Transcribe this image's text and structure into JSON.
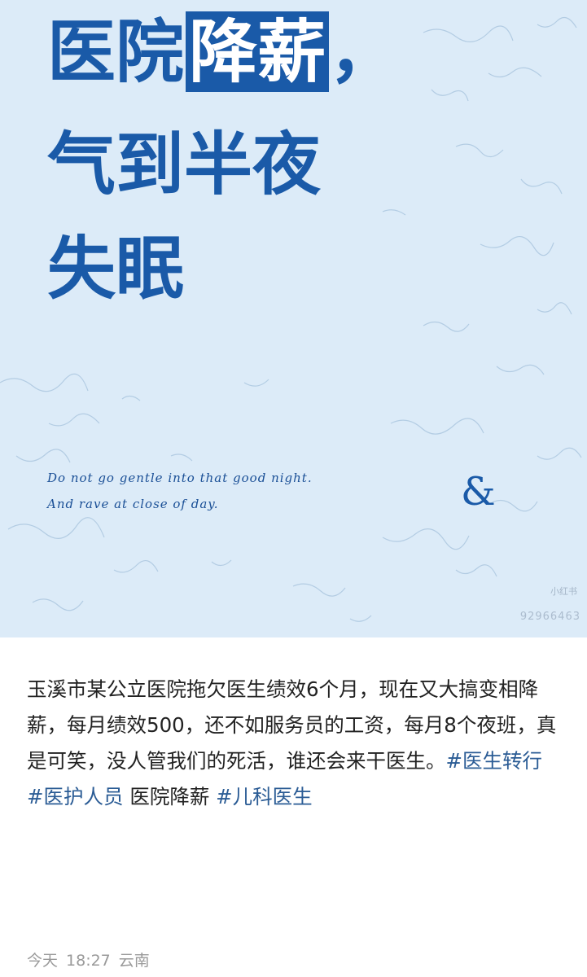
{
  "poster": {
    "headline": {
      "line1_plain": "医院",
      "line1_boxed": "降薪",
      "line1_comma": "，",
      "line2": "气到半夜",
      "line3": "失眠"
    },
    "script_line1": "Do not go gentle into that good night.",
    "script_line2": "And rave at close of day.",
    "ampersand": "&",
    "watermark": "小红书",
    "watermark_id": "92966463",
    "colors": {
      "accent": "#1a5aa8",
      "background": "#dcebf8"
    }
  },
  "post": {
    "text_1": "玉溪市某公立医院拖欠医生绩效6个月，现在又大搞变相降薪，每月绩效500，还不如服务员的工资，每月8个夜班，真是可笑，没人管我们的死活，谁还会来干医生。",
    "tag_1": "#医生转行",
    "tag_2": "#医护人员",
    "text_2": "医院降薪",
    "tag_3": "#儿科医生"
  },
  "meta": {
    "date": "今天",
    "time": "18:27",
    "location": "云南"
  }
}
